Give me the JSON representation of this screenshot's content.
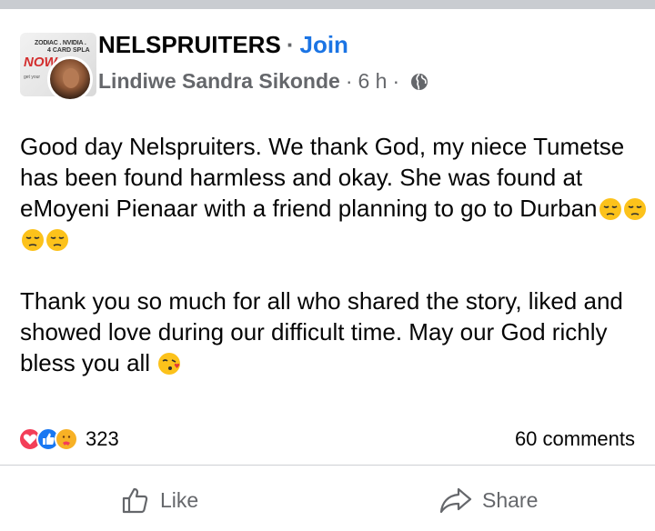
{
  "header": {
    "group_name": "NELSPRUITERS",
    "separator": "·",
    "join_label": "Join",
    "author": "Lindiwe Sandra Sikonde",
    "time": "6 h",
    "meta_dot": "·",
    "privacy_icon": "globe-icon",
    "group_avatar_text": {
      "line1": "ZODIAC . NVIDIA .",
      "line2": "4 CARD SPLA",
      "big": "NOW",
      "small": "get your"
    }
  },
  "post": {
    "paragraph1": "Good day Nelspruiters. We thank God, my niece Tumetse has been found harmless and okay. She was found at eMoyeni Pienaar with a friend planning to go to Durban",
    "paragraph1_emojis": [
      "pensive-face",
      "pensive-face",
      "pensive-face",
      "pensive-face"
    ],
    "paragraph2": "Thank you so much for all who shared the story, liked and showed love during our difficult time. May our God richly bless you all ",
    "paragraph2_emoji": "face-blowing-kiss"
  },
  "engagement": {
    "reaction_icons": [
      "love-reaction-icon",
      "like-reaction-icon",
      "care-reaction-icon"
    ],
    "reaction_count": "323",
    "comments_label": "60 comments"
  },
  "actions": {
    "like_label": "Like",
    "share_label": "Share"
  },
  "colors": {
    "accent": "#1b74e4",
    "secondary_text": "#65676b",
    "love": "#f33e58",
    "like": "#1877f2",
    "care": "#f7b125"
  }
}
